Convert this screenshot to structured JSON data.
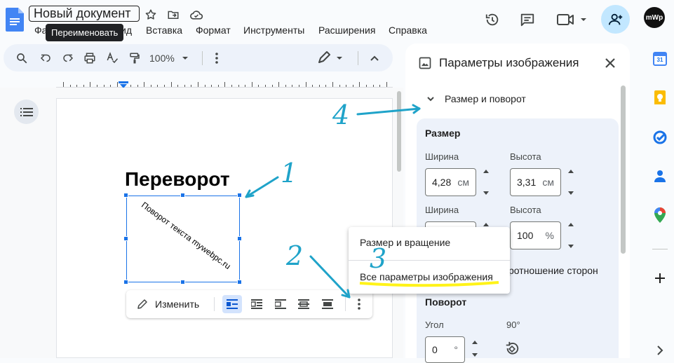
{
  "doc": {
    "title": "Новый документ"
  },
  "tooltip": {
    "rename": "Переименовать"
  },
  "menu": {
    "partial_file": "Фа",
    "partial_view": "ид",
    "insert": "Вставка",
    "format": "Формат",
    "tools": "Инструменты",
    "extensions": "Расширения",
    "help": "Справка"
  },
  "avatar": {
    "text": "mWp"
  },
  "toolbar": {
    "zoom": "100%"
  },
  "document": {
    "heading": "Переворот",
    "image_text": "Поворот текста mywebpc.ru"
  },
  "image_toolbar": {
    "edit_label": "Изменить"
  },
  "context_menu": {
    "item1": "Размер и вращение",
    "item2": "Все параметры изображения"
  },
  "panel": {
    "title": "Параметры изображения",
    "section": "Размер и поворот",
    "size_heading": "Размер",
    "width_label": "Ширина",
    "height_label": "Высота",
    "width_value": "4,28",
    "height_value": "3,31",
    "unit_cm": "см",
    "width2_label": "Ширина",
    "height2_label": "Высота",
    "height_pct_value": "100",
    "unit_pct": "%",
    "aspect_text_partial": "ротношение сторон",
    "rotation_heading": "Поворот",
    "angle_label": "Угол",
    "angle_value": "0",
    "angle_unit": "°",
    "rotate_90_label": "90°"
  },
  "calendar": {
    "day": "31"
  },
  "annotations": {
    "n1": "1",
    "n2": "2",
    "n3": "3",
    "n4": "4"
  },
  "colors": {
    "accent": "#1a73e8",
    "annotation": "#1fa3c9",
    "highlight": "#fff200",
    "panel_bg": "#edf2fa"
  }
}
